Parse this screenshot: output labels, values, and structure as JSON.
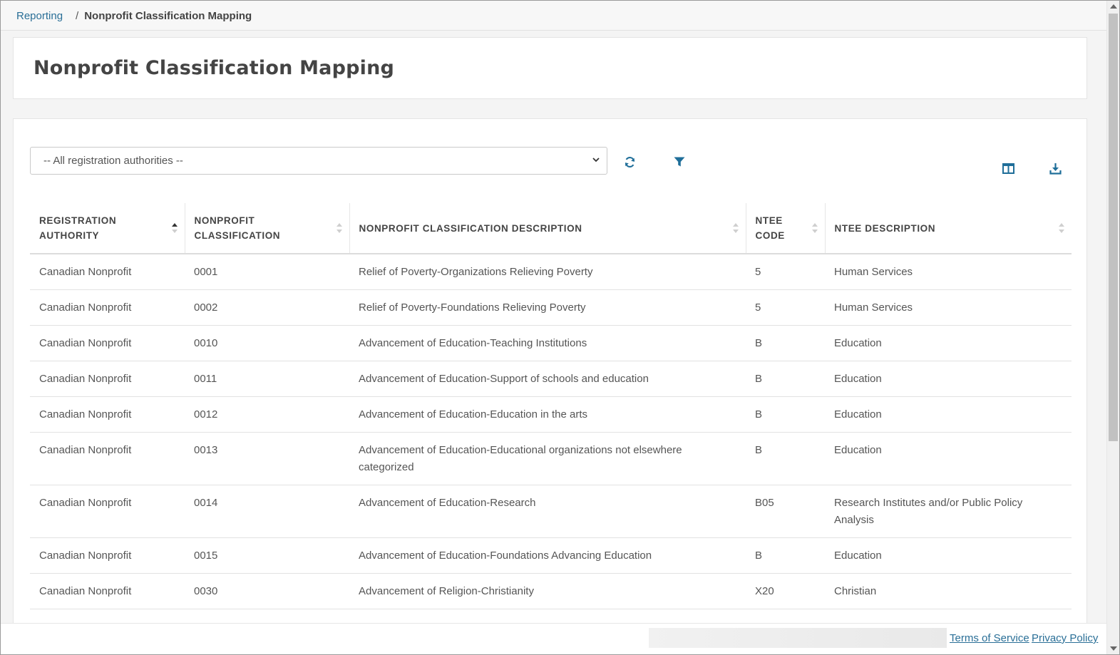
{
  "breadcrumb": {
    "parent": "Reporting",
    "separator": "/",
    "current": "Nonprofit Classification Mapping"
  },
  "page": {
    "title": "Nonprofit Classification Mapping"
  },
  "filters": {
    "authority_select": "-- All registration authorities --",
    "refresh_icon": "refresh-icon",
    "filter_icon": "filter-icon",
    "columns_icon": "columns-icon",
    "download_icon": "download-icon"
  },
  "colors": {
    "accent": "#2a6f97",
    "icon": "#1f6e99"
  },
  "table": {
    "columns": [
      {
        "label": "REGISTRATION AUTHORITY",
        "sort": "asc"
      },
      {
        "label": "NONPROFIT CLASSIFICATION",
        "sort": "none"
      },
      {
        "label": "NONPROFIT CLASSIFICATION DESCRIPTION",
        "sort": "none"
      },
      {
        "label": "NTEE CODE",
        "sort": "none"
      },
      {
        "label": "NTEE DESCRIPTION",
        "sort": "none"
      }
    ],
    "rows": [
      [
        "Canadian Nonprofit",
        "0001",
        "Relief of Poverty-Organizations Relieving Poverty",
        "5",
        "Human Services"
      ],
      [
        "Canadian Nonprofit",
        "0002",
        "Relief of Poverty-Foundations Relieving Poverty",
        "5",
        "Human Services"
      ],
      [
        "Canadian Nonprofit",
        "0010",
        "Advancement of Education-Teaching Institutions",
        "B",
        "Education"
      ],
      [
        "Canadian Nonprofit",
        "0011",
        "Advancement of Education-Support of schools and education",
        "B",
        "Education"
      ],
      [
        "Canadian Nonprofit",
        "0012",
        "Advancement of Education-Education in the arts",
        "B",
        "Education"
      ],
      [
        "Canadian Nonprofit",
        "0013",
        "Advancement of Education-Educational organizations not elsewhere categorized",
        "B",
        "Education"
      ],
      [
        "Canadian Nonprofit",
        "0014",
        "Advancement of Education-Research",
        "B05",
        "Research Institutes and/or Public Policy Analysis"
      ],
      [
        "Canadian Nonprofit",
        "0015",
        "Advancement of Education-Foundations Advancing Education",
        "B",
        "Education"
      ],
      [
        "Canadian Nonprofit",
        "0030",
        "Advancement of Religion-Christianity",
        "X20",
        "Christian"
      ]
    ]
  },
  "footer": {
    "terms": "Terms of Service",
    "privacy": "Privacy Policy"
  }
}
